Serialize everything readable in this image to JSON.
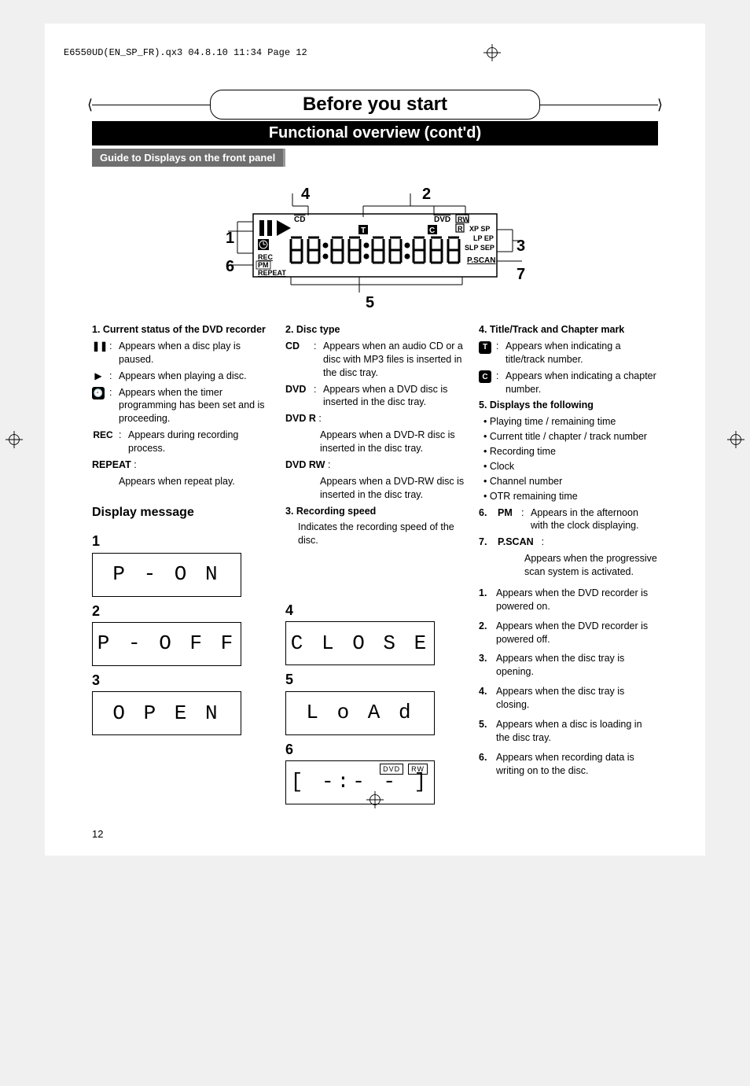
{
  "header_strip": "E6550UD(EN_SP_FR).qx3  04.8.10  11:34  Page 12",
  "main_title": "Before you start",
  "section_title": "Functional overview (cont'd)",
  "sub_title": "Guide to Displays on the front panel",
  "diagram": {
    "callouts": {
      "1": "1",
      "2": "2",
      "3": "3",
      "4": "4",
      "5": "5",
      "6": "6",
      "7": "7"
    },
    "labels": {
      "cd": "CD",
      "dvd": "DVD",
      "rw": "RW",
      "r": "R",
      "t": "T",
      "c": "C",
      "xp_sp": "XP SP",
      "lp_ep": "LP EP",
      "slp_sep": "SLP SEP",
      "pscan": "P.SCAN",
      "rec": "REC",
      "pm": "PM",
      "repeat": "REPEAT"
    }
  },
  "col1": {
    "h1": "1.  Current status of the DVD recorder",
    "pause": "Appears when a disc play is paused.",
    "play": "Appears when playing a disc.",
    "timer": "Appears when the timer programming has been set and is proceeding.",
    "rec_label": "REC",
    "rec": "Appears during recording process.",
    "repeat_label": "REPEAT",
    "repeat_colon": ":",
    "repeat": "Appears when repeat play."
  },
  "col2": {
    "h2": "2.  Disc type",
    "cd_label": "CD",
    "cd": "Appears when an audio CD or a disc with MP3 files is inserted in the disc tray.",
    "dvd_label": "DVD",
    "dvd": "Appears when a DVD disc is inserted in the disc tray.",
    "dvd_r_label": "DVD   R",
    "dvd_r": "Appears when a DVD-R disc is inserted in the disc tray.",
    "dvd_rw_label": "DVD   RW",
    "dvd_rw": "Appears when a DVD-RW disc is inserted in the disc tray.",
    "h3": "3.  Recording speed",
    "rec_speed": "Indicates the recording speed of the disc."
  },
  "col3": {
    "h4": "4.  Title/Track and Chapter mark",
    "t": "Appears when indicating a title/track number.",
    "c": "Appears when indicating a chapter number.",
    "h5": "5.  Displays the following",
    "bullets": [
      "Playing time / remaining time",
      "Current title / chapter / track number",
      "Recording time",
      "Clock",
      "Channel number",
      "OTR remaining time"
    ],
    "h6_label": "6.",
    "pm_label": "PM",
    "pm": "Appears in the afternoon with the clock displaying.",
    "h7_label": "7.",
    "pscan_label": "P.SCAN",
    "pscan": "Appears when the progressive scan system is activated.",
    "rlist": [
      "Appears when the DVD recorder is powered on.",
      "Appears when the DVD recorder is powered off.",
      "Appears when the disc tray is opening.",
      "Appears when the disc tray is closing.",
      "Appears when a disc is loading in the disc tray.",
      "Appears when recording data is writing on to the disc."
    ]
  },
  "display_message_title": "Display message",
  "msg": {
    "n1": "1",
    "t1": "P - O N",
    "n2": "2",
    "t2": "P - O F F",
    "n3": "3",
    "t3": "O P E N",
    "n4": "4",
    "t4": "C L O S E",
    "n5": "5",
    "t5": "L o A d",
    "n6": "6",
    "t6": "[ -:- - ]",
    "sub_dvd": "DVD",
    "sub_rw": "RW"
  },
  "page_number": "12",
  "colon": ":"
}
